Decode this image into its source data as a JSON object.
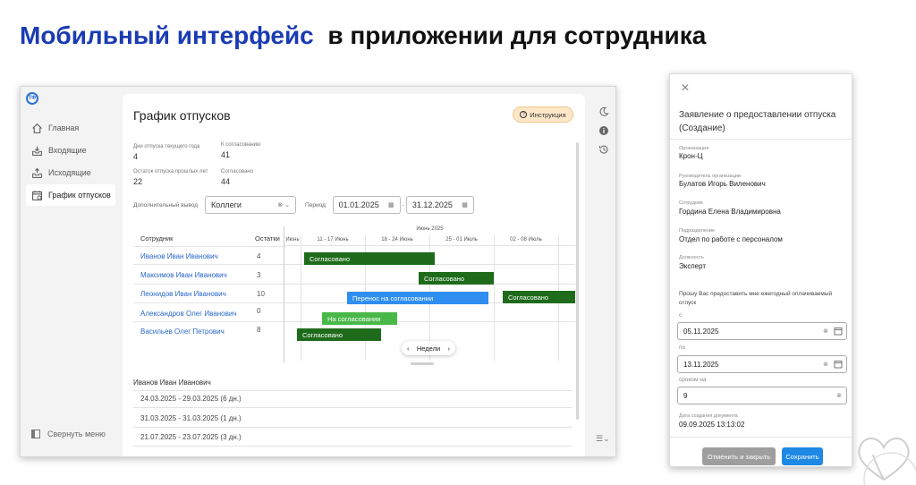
{
  "slide": {
    "title_accent": "Мобильный интерфейс",
    "title_rest": "в приложении для сотрудника"
  },
  "colors": {
    "accent": "#1a3bb3",
    "approved": "#1e6b1b",
    "transfer": "#2f8ef0",
    "pending": "#49b849",
    "save": "#1e88e5",
    "cancel": "#9e9e9e"
  },
  "desktop": {
    "logo": "ТФ",
    "nav": [
      {
        "label": "Главная",
        "icon": "home-icon"
      },
      {
        "label": "Входящие",
        "icon": "inbox-icon"
      },
      {
        "label": "Исходящие",
        "icon": "outbox-icon"
      },
      {
        "label": "График отпусков",
        "icon": "calendar-icon"
      }
    ],
    "collapse_label": "Свернуть меню",
    "page_title": "График отпусков",
    "instruction_label": "Инструкция",
    "stats": {
      "days_current_label": "Дни отпуска текущего года",
      "days_current_value": "4",
      "to_approve_label": "К согласованию",
      "to_approve_value": "41",
      "remaining_label": "Остаток отпуска прошлых лет",
      "remaining_value": "22",
      "approved_label": "Согласовано",
      "approved_value": "44"
    },
    "filters": {
      "extra_label": "Дополнительный вывод",
      "extra_value": "Коллеги",
      "period_label": "Период:",
      "date_from": "01.01.2025",
      "date_to": "31.12.2025"
    },
    "table": {
      "col_employee": "Сотрудник",
      "col_rest": "Остатки",
      "rows": [
        {
          "name": "Иванов Иван Иванович",
          "rest": "4"
        },
        {
          "name": "Максимов Иван Иванович",
          "rest": "3"
        },
        {
          "name": "Леонидов Иван Иванович",
          "rest": "10"
        },
        {
          "name": "Александров Олег Иванович",
          "rest": "0"
        },
        {
          "name": "Васильев Олег Петрович",
          "rest": "8"
        }
      ]
    },
    "gantt": {
      "month": "Июнь 2025",
      "weeks": [
        "Июнь",
        "11 - 17 Июнь",
        "18 - 24 Июнь",
        "25 - 01 Июль",
        "02 - 08 Июль"
      ],
      "bars": [
        {
          "label": "Согласовано",
          "status": "approved"
        },
        {
          "label": "Согласовано",
          "status": "approved"
        },
        {
          "label": "Перенос на согласовании",
          "status": "transfer"
        },
        {
          "label": "Согласовано",
          "status": "approved"
        },
        {
          "label": "На согласовании",
          "status": "pending"
        },
        {
          "label": "Согласовано",
          "status": "approved"
        }
      ],
      "zoom_label": "Недели"
    },
    "selected_employee": "Иванов Иван Иванович",
    "periods": [
      "24.03.2025 - 29.03.2025 (6 дн.)",
      "31.03.2025 - 31.03.2025 (1 дн.)",
      "21.07.2025 - 23.07.2025 (3 дн.)"
    ]
  },
  "mobile": {
    "title": "Заявление о предоставлении отпуска (Создание)",
    "fields": [
      {
        "label": "Организация",
        "value": "Крон-Ц"
      },
      {
        "label": "Руководитель организации",
        "value": "Булатов Игорь Виленович"
      },
      {
        "label": "Сотрудник",
        "value": "Гордина Елена Владимировна"
      },
      {
        "label": "Подразделение",
        "value": "Отдел по работе с персоналом"
      },
      {
        "label": "Должность",
        "value": "Эксперт"
      }
    ],
    "request_text": "Прошу Вас предоставить мне ежегодный оплачиваемый отпуск",
    "from_label": "с",
    "from_value": "05.11.2025",
    "to_label": "по",
    "to_value": "13.11.2025",
    "term_label": "сроком на",
    "term_value": "9",
    "created_label": "Дата создания документа",
    "created_value": "09.09.2025 13:13:02",
    "cancel_label": "Отменить и закрыть",
    "save_label": "Сохранить"
  }
}
